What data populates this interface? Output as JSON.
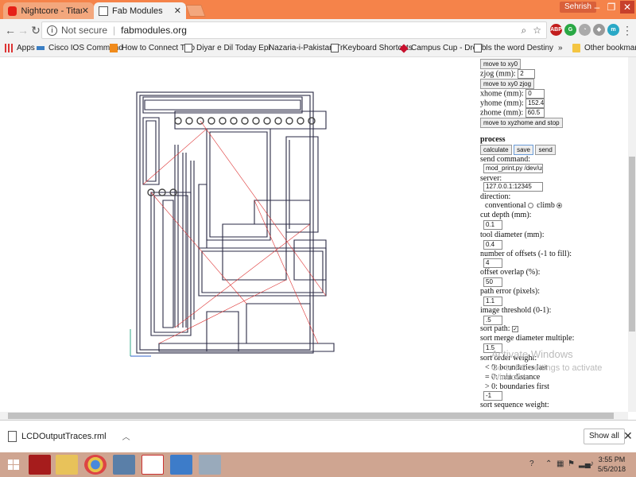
{
  "tabs": [
    {
      "title": "Nightcore - Titanium (Ly",
      "icon": "youtube-icon"
    },
    {
      "title": "Fab Modules",
      "icon": "page-icon"
    }
  ],
  "window": {
    "user": "Sehrish"
  },
  "address": {
    "security": "Not secure",
    "url": "fabmodules.org"
  },
  "bookmarks": [
    {
      "label": "Apps",
      "icon": "apps-icon"
    },
    {
      "label": "Cisco IOS Command",
      "icon": "cisco-icon"
    },
    {
      "label": "How to Connect Two",
      "icon": "pit-icon"
    },
    {
      "label": "Diyar e Dil Today Epi",
      "icon": "page-icon"
    },
    {
      "label": "Nazaria-i-Pakistan Tr",
      "icon": "blank-icon"
    },
    {
      "label": "Keyboard Shortcuts",
      "icon": "page-icon"
    },
    {
      "label": "Campus Cup - Dropb",
      "icon": "dropbox-icon"
    },
    {
      "label": "Is the word Destiny",
      "icon": "page-icon"
    },
    {
      "label": "»",
      "icon": ""
    },
    {
      "label": "Other bookmarks",
      "icon": "folder-icon"
    }
  ],
  "panel": {
    "move_xy0": "move to xy0",
    "zjog_label": "zjog (mm):",
    "zjog_value": "2",
    "move_xy0_zjog": "move to xy0 zjog",
    "xhome_label": "xhome (mm):",
    "xhome_value": "0",
    "yhome_label": "yhome (mm):",
    "yhome_value": "152.4",
    "zhome_label": "zhome (mm):",
    "zhome_value": "60.5",
    "move_xyzhome": "move to xyzhome and stop",
    "process_heading": "process",
    "calculate": "calculate",
    "save": "save",
    "send": "send",
    "send_command_label": "send command:",
    "send_command_value": "mod_print.py /dev/usb/lp1 ;",
    "server_label": "server:",
    "server_value": "127.0.0.1:12345",
    "direction_label": "direction:",
    "conventional": "conventional",
    "climb": "climb",
    "cut_depth_label": "cut depth (mm):",
    "cut_depth_value": "0.1",
    "tool_diameter_label": "tool diameter (mm):",
    "tool_diameter_value": "0.4",
    "offsets_label": "number of offsets (-1 to fill):",
    "offsets_value": "4",
    "overlap_label": "offset overlap (%):",
    "overlap_value": "50",
    "path_error_label": "path error (pixels):",
    "path_error_value": "1.1",
    "threshold_label": "image threshold (0-1):",
    "threshold_value": ".5",
    "sort_path_label": "sort path:",
    "sort_merge_label": "sort merge diameter multiple:",
    "sort_merge_value": "1.5",
    "sort_order_label": "sort order weight:",
    "sort_order_lt": "< 0: boundaries last",
    "sort_order_eq": "= 0: min distance",
    "sort_order_gt": "> 0: boundaries first",
    "sort_order_value": "-1",
    "sort_sequence_label": "sort sequence weight:"
  },
  "watermark": {
    "title": "Activate Windows",
    "subtitle": "Go to PC settings to activate Windows."
  },
  "download": {
    "filename": "LCDOutputTraces.rml",
    "show_all": "Show all"
  },
  "taskbar": {
    "time": "3:55 PM",
    "date": "5/5/2018"
  }
}
